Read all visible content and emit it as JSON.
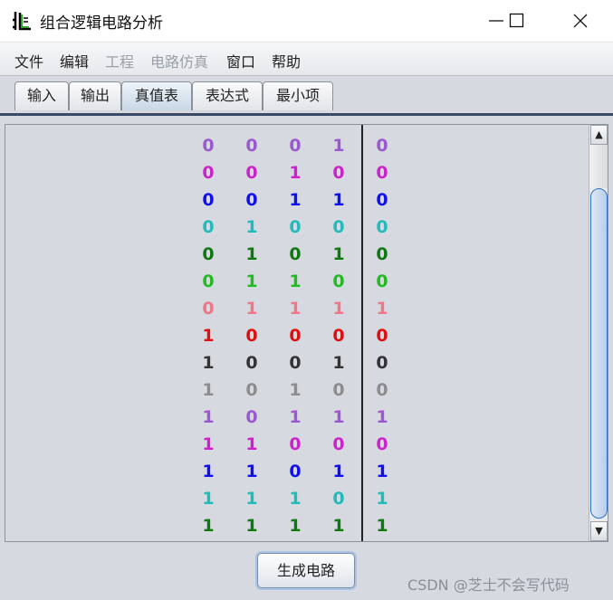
{
  "window": {
    "title": "组合逻辑电路分析",
    "icon": "circuit-icon"
  },
  "menu": [
    {
      "label": "文件",
      "enabled": true
    },
    {
      "label": "编辑",
      "enabled": true
    },
    {
      "label": "工程",
      "enabled": false
    },
    {
      "label": "电路仿真",
      "enabled": false
    },
    {
      "label": "窗口",
      "enabled": true
    },
    {
      "label": "帮助",
      "enabled": true
    }
  ],
  "tabs": [
    {
      "label": "输入",
      "active": false
    },
    {
      "label": "输出",
      "active": false
    },
    {
      "label": "真值表",
      "active": true
    },
    {
      "label": "表达式",
      "active": false
    },
    {
      "label": "最小项",
      "active": false
    }
  ],
  "truth_table": {
    "rows": [
      {
        "inputs": [
          "0",
          "0",
          "0",
          "1"
        ],
        "output": "0",
        "color": "#9b59d0"
      },
      {
        "inputs": [
          "0",
          "0",
          "1",
          "0"
        ],
        "output": "0",
        "color": "#cc22cc"
      },
      {
        "inputs": [
          "0",
          "0",
          "1",
          "1"
        ],
        "output": "0",
        "color": "#1010ee"
      },
      {
        "inputs": [
          "0",
          "1",
          "0",
          "0"
        ],
        "output": "0",
        "color": "#22bbbb"
      },
      {
        "inputs": [
          "0",
          "1",
          "0",
          "1"
        ],
        "output": "0",
        "color": "#117711"
      },
      {
        "inputs": [
          "0",
          "1",
          "1",
          "0"
        ],
        "output": "0",
        "color": "#22bb22"
      },
      {
        "inputs": [
          "0",
          "1",
          "1",
          "1"
        ],
        "output": "1",
        "color": "#ee7788"
      },
      {
        "inputs": [
          "1",
          "0",
          "0",
          "0"
        ],
        "output": "0",
        "color": "#dd1111"
      },
      {
        "inputs": [
          "1",
          "0",
          "0",
          "1"
        ],
        "output": "0",
        "color": "#333333"
      },
      {
        "inputs": [
          "1",
          "0",
          "1",
          "0"
        ],
        "output": "0",
        "color": "#8c8c8c"
      },
      {
        "inputs": [
          "1",
          "0",
          "1",
          "1"
        ],
        "output": "1",
        "color": "#9b59d0"
      },
      {
        "inputs": [
          "1",
          "1",
          "0",
          "0"
        ],
        "output": "0",
        "color": "#cc22cc"
      },
      {
        "inputs": [
          "1",
          "1",
          "0",
          "1"
        ],
        "output": "1",
        "color": "#1010ee"
      },
      {
        "inputs": [
          "1",
          "1",
          "1",
          "0"
        ],
        "output": "1",
        "color": "#22bbbb"
      },
      {
        "inputs": [
          "1",
          "1",
          "1",
          "1"
        ],
        "output": "1",
        "color": "#117711"
      }
    ]
  },
  "buttons": {
    "generate": "生成电路"
  },
  "watermark": "CSDN @芝士不会写代码"
}
